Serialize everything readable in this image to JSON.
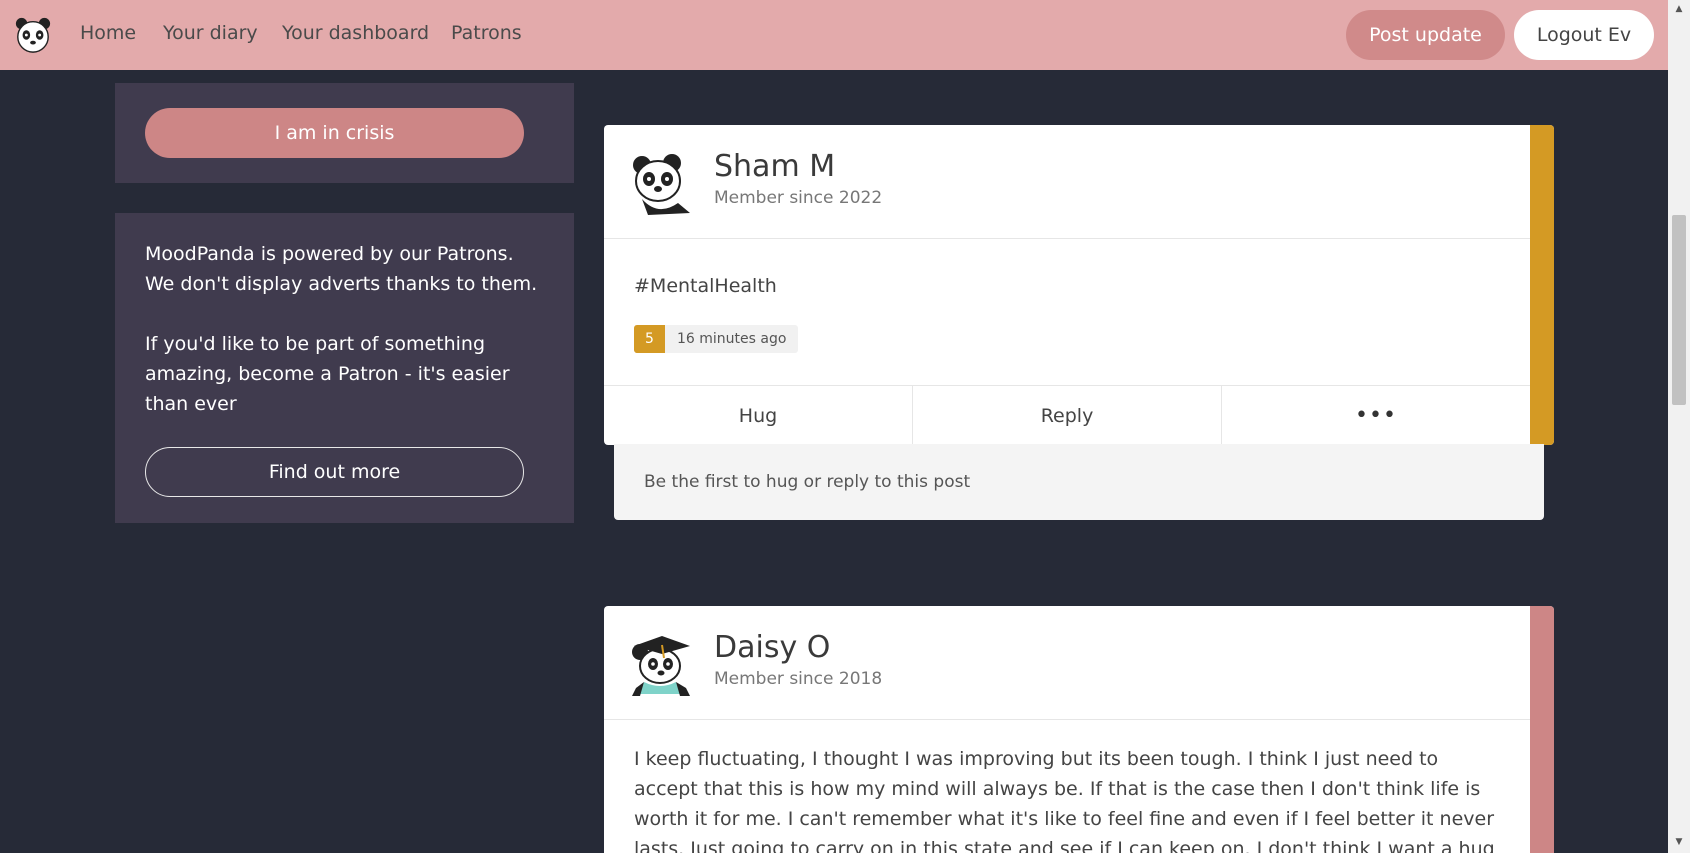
{
  "nav": {
    "links": [
      "Home",
      "Your diary",
      "Your dashboard",
      "Patrons"
    ],
    "post_update": "Post update",
    "logout": "Logout Ev"
  },
  "sidebar": {
    "crisis_button": "I am in crisis",
    "patron_line1": "MoodPanda is powered by our Patrons. We don't display adverts thanks to them.",
    "patron_line2": "If you'd like to be part of something amazing, become a Patron - it's easier than ever",
    "find_out_more": "Find out more"
  },
  "posts": [
    {
      "name": "Sham M",
      "since": "Member since 2022",
      "text": "#MentalHealth",
      "mood": "5",
      "time": "16 minutes ago",
      "bar_color": "#d49a24",
      "actions": [
        "Hug",
        "Reply",
        "•••"
      ],
      "reply_prompt": "Be the first to hug or reply to this post"
    },
    {
      "name": "Daisy O",
      "since": "Member since 2018",
      "text": "I keep fluctuating, I thought I was improving but its been tough. I think I just need to accept that this is how my mind will always be. If that is the case then I don't think life is worth it for me. I can't remember what it's like to feel fine and even if I feel better it never lasts. Just going to carry on in this state and see if I can keep on. I don't think I want a hug but cant",
      "bar_color": "#cd8686"
    }
  ],
  "icons": {
    "logo": "panda-logo-icon",
    "avatar1": "panda-avatar-icon",
    "avatar2": "panda-graduate-avatar-icon",
    "more": "more-dots-icon"
  },
  "colors": {
    "navbar": "#e3aaab",
    "background": "#262a37",
    "sidebar_card": "#403b4e",
    "crisis": "#cd8686",
    "mood_5": "#d49a24"
  }
}
